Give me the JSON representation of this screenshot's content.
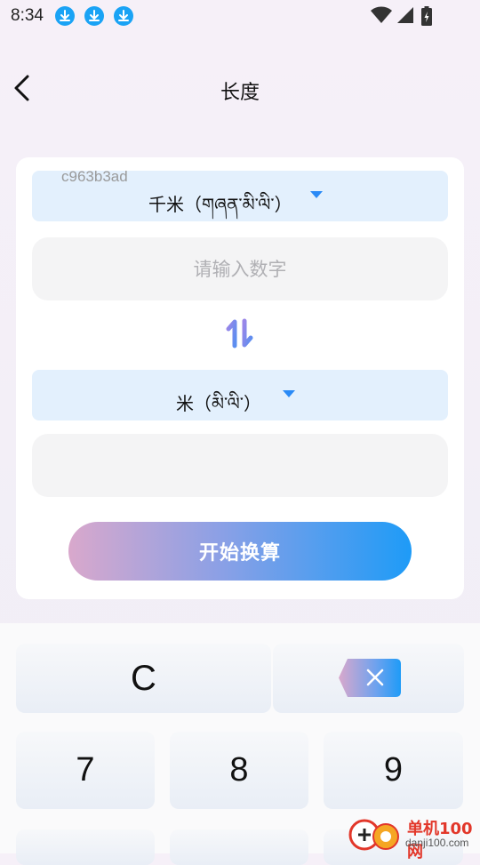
{
  "status_bar": {
    "time": "8:34",
    "notification_icons": [
      "download-icon",
      "download-icon",
      "download-icon"
    ],
    "system_icons": [
      "wifi-icon",
      "signal-icon",
      "battery-icon"
    ]
  },
  "header": {
    "title": "长度",
    "back_icon": "chevron-left-icon"
  },
  "converter": {
    "watermark_id": "c963b3ad",
    "from_unit": "千米（གཞན་མི་ལི་）",
    "input_placeholder": "请输入数字",
    "input_value": "",
    "swap_icon": "swap-vertical-icon",
    "to_unit": "米（མི་ལི་）",
    "result_value": "",
    "convert_label": "开始换算",
    "accent_color": "#2a8af6"
  },
  "keypad": {
    "clear_label": "C",
    "backspace_icon": "backspace-icon",
    "keys": [
      "7",
      "8",
      "9"
    ]
  },
  "site_watermark": {
    "name": "单机100网",
    "url": "danji100.com"
  }
}
